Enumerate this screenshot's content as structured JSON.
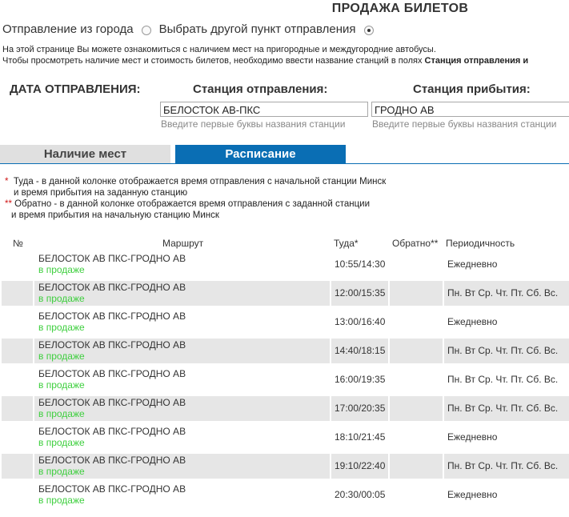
{
  "page_title": "ПРОДАЖА БИЛЕТОВ",
  "departure_options": {
    "city_label": "Отправление из города",
    "other_label": "Выбрать другой пункт отправления",
    "selected": "other"
  },
  "info": {
    "line1": "На этой странице Вы можете ознакомиться с наличием мест на пригородные и междугородние автобусы.",
    "line2_prefix": "Чтобы просмотреть наличие мест и стоимость билетов, необходимо ввести название станций в полях ",
    "line2_bold": "Станция отправления и"
  },
  "form": {
    "date_label": "ДАТА ОТПРАВЛЕНИЯ:",
    "departure_label": "Станция отправления:",
    "departure_value": "БЕЛОСТОК АВ-ПКС",
    "departure_hint": "Введите первые буквы названия станции",
    "arrival_label": "Станция прибытия:",
    "arrival_value": "ГРОДНО АВ",
    "arrival_hint": "Введите первые буквы названия станции"
  },
  "tabs": {
    "availability": "Наличие мест",
    "schedule": "Расписание",
    "active": "schedule"
  },
  "notes": {
    "star1": "*",
    "line1": "Туда - в данной колонке отображается время отправления с начальной станции Минск",
    "line1b": "и время прибытия на заданную станцию",
    "star2": "**",
    "line2": "Обратно - в данной колонке отображается время отправления с заданной станции",
    "line2b": "и время прибытия на начальную станцию Минск"
  },
  "table": {
    "headers": {
      "num": "№",
      "route": "Маршрут",
      "there": "Туда*",
      "back": "Обратно**",
      "period": "Периодичность"
    },
    "rows": [
      {
        "route": "БЕЛОСТОК АВ ПКС-ГРОДНО АВ",
        "status": "в продаже",
        "there": "10:55/14:30",
        "back": "",
        "period": "Ежедневно"
      },
      {
        "route": "БЕЛОСТОК АВ ПКС-ГРОДНО АВ",
        "status": "в продаже",
        "there": "12:00/15:35",
        "back": "",
        "period": "Пн. Вт Ср. Чт. Пт. Сб. Вс."
      },
      {
        "route": "БЕЛОСТОК АВ ПКС-ГРОДНО АВ",
        "status": "в продаже",
        "there": "13:00/16:40",
        "back": "",
        "period": "Ежедневно"
      },
      {
        "route": "БЕЛОСТОК АВ ПКС-ГРОДНО АВ",
        "status": "в продаже",
        "there": "14:40/18:15",
        "back": "",
        "period": "Пн. Вт Ср. Чт. Пт. Сб. Вс."
      },
      {
        "route": "БЕЛОСТОК АВ ПКС-ГРОДНО АВ",
        "status": "в продаже",
        "there": "16:00/19:35",
        "back": "",
        "period": "Пн. Вт Ср. Чт. Пт. Сб. Вс."
      },
      {
        "route": "БЕЛОСТОК АВ ПКС-ГРОДНО АВ",
        "status": "в продаже",
        "there": "17:00/20:35",
        "back": "",
        "period": "Пн. Вт Ср. Чт. Пт. Сб. Вс."
      },
      {
        "route": "БЕЛОСТОК АВ ПКС-ГРОДНО АВ",
        "status": "в продаже",
        "there": "18:10/21:45",
        "back": "",
        "period": "Ежедневно"
      },
      {
        "route": "БЕЛОСТОК АВ ПКС-ГРОДНО АВ",
        "status": "в продаже",
        "there": "19:10/22:40",
        "back": "",
        "period": "Пн. Вт Ср. Чт. Пт. Сб. Вс."
      },
      {
        "route": "БЕЛОСТОК АВ ПКС-ГРОДНО АВ",
        "status": "в продаже",
        "there": "20:30/00:05",
        "back": "",
        "period": "Ежедневно"
      }
    ]
  },
  "colors": {
    "active_tab": "#0a6eb4",
    "status_green": "#3ecf3e",
    "note_star": "#d01818",
    "row_shade": "#e6e6e6"
  }
}
